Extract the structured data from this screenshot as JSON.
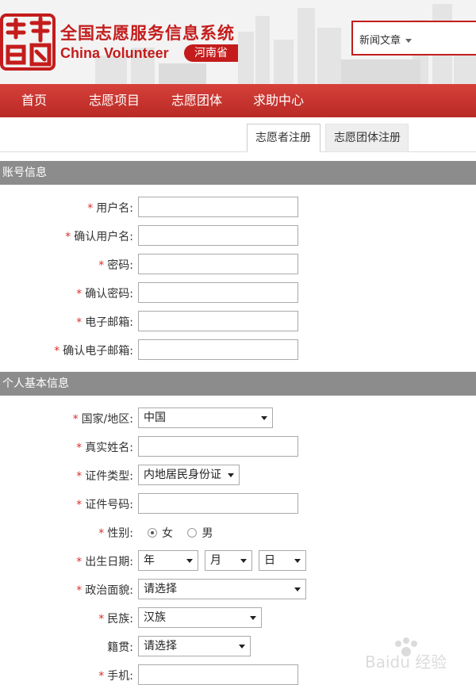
{
  "header": {
    "title_cn": "全国志愿服务信息系统",
    "title_en": "China Volunteer",
    "province": "河南省",
    "search_select": "新闻文章"
  },
  "nav": [
    "首页",
    "志愿项目",
    "志愿团体",
    "求助中心"
  ],
  "tabs": [
    "志愿者注册",
    "志愿团体注册"
  ],
  "sections": {
    "account": "账号信息",
    "personal": "个人基本信息"
  },
  "account_fields": [
    "用户名:",
    "确认用户名:",
    "密码:",
    "确认密码:",
    "电子邮箱:",
    "确认电子邮箱:"
  ],
  "personal": {
    "country_label": "国家/地区:",
    "country_value": "中国",
    "name_label": "真实姓名:",
    "idtype_label": "证件类型:",
    "idtype_value": "内地居民身份证",
    "idnum_label": "证件号码:",
    "gender_label": "性别:",
    "gender_options": [
      "女",
      "男"
    ],
    "gender_selected": "女",
    "birth_label": "出生日期:",
    "birth_year": "年",
    "birth_month": "月",
    "birth_day": "日",
    "political_label": "政治面貌:",
    "political_value": "请选择",
    "ethnic_label": "民族:",
    "ethnic_value": "汉族",
    "native_label": "籍贯:",
    "native_value": "请选择",
    "phone_label": "手机:"
  },
  "required_mark": "*",
  "watermark": "Baidu 经验",
  "colors": {
    "brand_red": "#c41c1c",
    "nav_red": "#c9302c",
    "section_gray": "#8c8c8c"
  }
}
